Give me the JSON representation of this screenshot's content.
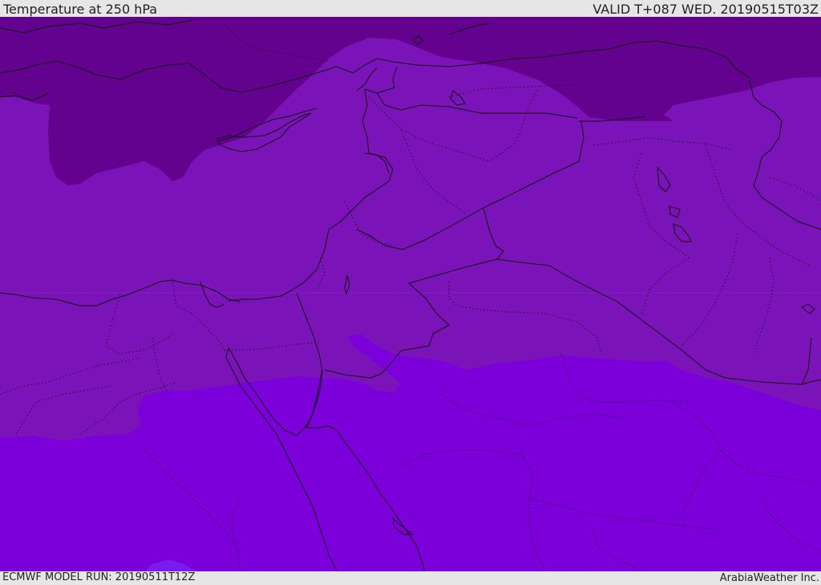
{
  "header": {
    "title": "Temperature at 250 hPa",
    "valid": "VALID T+087 WED. 20190515T03Z"
  },
  "footer": {
    "model_run": "ECMWF MODEL RUN: 20190511T12Z",
    "credit": "ArabiaWeather Inc."
  },
  "colors": {
    "cold_band": "#62028f",
    "mid_band": "#7a14b8",
    "warm_band": "#7c00d9",
    "warmest_band": "#7a1bf0",
    "coastline": "#111111",
    "borders": "#111111"
  }
}
